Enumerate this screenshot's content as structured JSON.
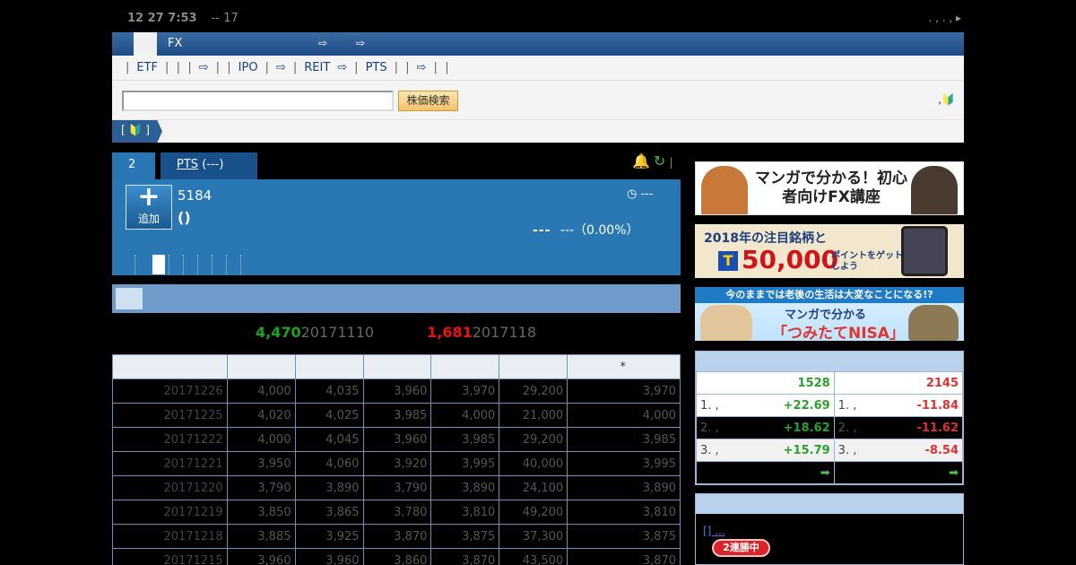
{
  "header": {
    "time": "12 27 7:53",
    "ticker_note": "-- 17"
  },
  "nav": {
    "fx_label": "FX"
  },
  "subnav": {
    "items": [
      "ETF",
      "IPO",
      "REIT",
      "PTS"
    ]
  },
  "search": {
    "placeholder": "",
    "button_label": "株価検索"
  },
  "tabs": {
    "tab1": "2",
    "tab2_link": "PTS",
    "tab2_suffix": "(---)"
  },
  "quote": {
    "add_label": "追加",
    "code": "5184",
    "paren": "()",
    "status": "---",
    "price_dash": "---",
    "change": "---（0.00%）"
  },
  "hilo": {
    "high_value": "4,470",
    "high_date": "20171110",
    "low_value": "1,681",
    "low_date": "2017118"
  },
  "history_table": {
    "header_note": "*",
    "rows": [
      [
        "20171226",
        "4,000",
        "4,035",
        "3,960",
        "3,970",
        "29,200",
        "3,970"
      ],
      [
        "20171225",
        "4,020",
        "4,025",
        "3,985",
        "4,000",
        "21,000",
        "4,000"
      ],
      [
        "20171222",
        "4,000",
        "4,045",
        "3,960",
        "3,985",
        "29,200",
        "3,985"
      ],
      [
        "20171221",
        "3,950",
        "4,060",
        "3,920",
        "3,995",
        "40,000",
        "3,995"
      ],
      [
        "20171220",
        "3,790",
        "3,890",
        "3,790",
        "3,890",
        "24,100",
        "3,890"
      ],
      [
        "20171219",
        "3,850",
        "3,865",
        "3,780",
        "3,810",
        "49,200",
        "3,810"
      ],
      [
        "20171218",
        "3,885",
        "3,925",
        "3,870",
        "3,875",
        "37,300",
        "3,875"
      ],
      [
        "20171215",
        "3,960",
        "3,960",
        "3,860",
        "3,870",
        "43,500",
        "3,870"
      ]
    ]
  },
  "banners": {
    "b1": "マンガで分かる！初心者向けFX講座",
    "b2_a": "2018年の注目銘柄と",
    "b2_b": "50,000",
    "b2_c": "ポイントをゲットしよう",
    "b3_a": "今のままでは老後の生活は大変なことになる!?",
    "b3_b": "マンガで分かる",
    "b3_c": "「つみたてNISA」"
  },
  "ranking": {
    "up_count": "1528",
    "down_count": "2145",
    "rows": [
      {
        "up_rank": "1. ,",
        "up_val": "+22.69",
        "down_rank": "1. ,",
        "down_val": "-11.84"
      },
      {
        "up_rank": "2. ,",
        "up_val": "+18.62",
        "down_rank": "2. ,",
        "down_val": "-11.62"
      },
      {
        "up_rank": "3. ,",
        "up_val": "+15.79",
        "down_rank": "3. ,",
        "down_val": "-8.54"
      }
    ]
  },
  "box2": {
    "link": "[] ...",
    "streak_label": "2連勝中"
  }
}
